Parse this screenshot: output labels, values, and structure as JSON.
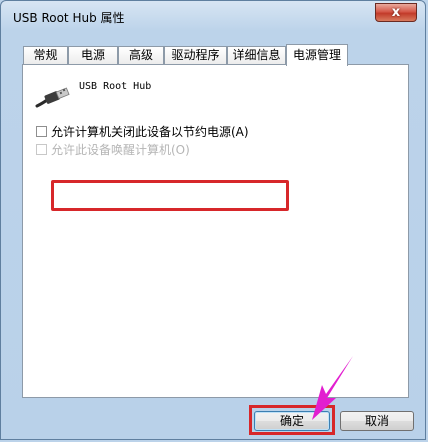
{
  "window": {
    "title": "USB Root Hub 属性",
    "close_label": "x"
  },
  "tabs": [
    {
      "label": "常规"
    },
    {
      "label": "电源"
    },
    {
      "label": "高级"
    },
    {
      "label": "驱动程序"
    },
    {
      "label": "详细信息"
    },
    {
      "label": "电源管理"
    }
  ],
  "active_tab": "电源管理",
  "panel": {
    "device_name": "USB Root Hub",
    "options": [
      {
        "label": "允许计算机关闭此设备以节约电源(A)",
        "checked": false,
        "enabled": true
      },
      {
        "label": "允许此设备唤醒计算机(O)",
        "checked": false,
        "enabled": false
      }
    ]
  },
  "buttons": {
    "ok_label": "确定",
    "cancel_label": "取消"
  },
  "colors": {
    "annotation_red": "#d7272a",
    "annotation_arrow": "#e21fd0",
    "window_frame": "#bcd3ea"
  }
}
